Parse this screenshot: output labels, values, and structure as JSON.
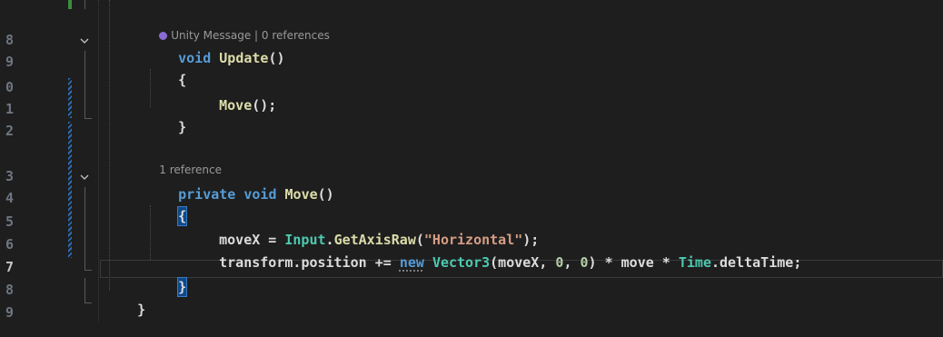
{
  "line_numbers": [
    "8",
    "9",
    "0",
    "1",
    "2",
    "3",
    "4",
    "5",
    "6",
    "7",
    "8",
    "9"
  ],
  "active_line_number": "7",
  "codelens": {
    "update": "Unity Message | 0 references",
    "move": "1 reference"
  },
  "code": {
    "l8_kw": "void",
    "l8_fn": "Update",
    "l8_rest": "()",
    "l9_brace": "{",
    "l10_fn": "Move",
    "l10_rest": "();",
    "l11_brace": "}",
    "l13_kw1": "private",
    "l13_kw2": "void",
    "l13_fn": "Move",
    "l13_rest": "()",
    "l14_brace": "{",
    "l15_var": "moveX",
    "l15_eq": " = ",
    "l15_ty": "Input",
    "l15_dot": ".",
    "l15_fn": "GetAxisRaw",
    "l15_open": "(",
    "l15_str": "\"Horizontal\"",
    "l15_close": ");",
    "l16_var": "transform",
    "l16_dot": ".",
    "l16_prop": "position",
    "l16_op": " += ",
    "l16_kw": "new",
    "l16_sp": " ",
    "l16_ty": "Vector3",
    "l16_open": "(moveX, ",
    "l16_n1": "0",
    "l16_comma": ", ",
    "l16_n2": "0",
    "l16_mid": ") * move * ",
    "l16_ty2": "Time",
    "l16_dot2": ".",
    "l16_prop2": "deltaTime",
    "l16_end": ";",
    "l17_brace": "}",
    "l18_brace": "}"
  },
  "colors": {
    "background": "#1e1e1e",
    "keyword": "#569cd6",
    "method": "#dcdcaa",
    "type": "#4ec9b0",
    "string": "#d69d85",
    "number": "#b5cea8",
    "change_bar": "#2b6cb5"
  },
  "icons": {
    "fold_update": "chevron-down-icon",
    "fold_move": "chevron-down-icon",
    "codelens_unity": "unity-message-icon"
  }
}
